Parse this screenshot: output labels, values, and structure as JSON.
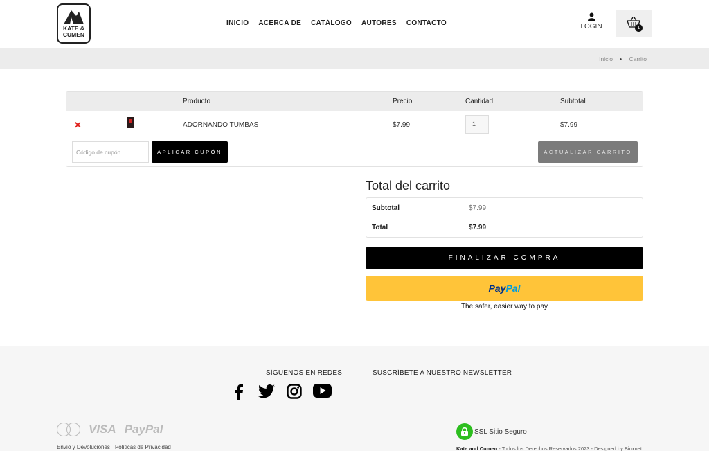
{
  "brand": {
    "logo_text_line1": "KATE &",
    "logo_text_line2": "CUMEN"
  },
  "nav": {
    "items": [
      "INICIO",
      "ACERCA DE",
      "CATÁLOGO",
      "AUTORES",
      "CONTACTO"
    ]
  },
  "header": {
    "login_label": "LOGIN",
    "cart_count": "1"
  },
  "breadcrumb": {
    "home": "Inicio",
    "current": "Carrito"
  },
  "cart": {
    "columns": {
      "product": "Producto",
      "price": "Precio",
      "quantity": "Cantidad",
      "subtotal": "Subtotal"
    },
    "items": [
      {
        "name": "ADORNANDO TUMBAS",
        "price": "$7.99",
        "quantity": "1",
        "subtotal": "$7.99"
      }
    ],
    "coupon_placeholder": "Código de cupón",
    "apply_coupon_label": "APLICAR CUPÓN",
    "update_cart_label": "ACTUALIZAR CARRITO"
  },
  "totals": {
    "title": "Total del carrito",
    "subtotal_label": "Subtotal",
    "subtotal_value": "$7.99",
    "total_label": "Total",
    "total_value": "$7.99",
    "checkout_label": "FINALIZAR COMPRA",
    "paypal_pay": "Pay",
    "paypal_pal": "Pal",
    "paypal_tagline": "The safer, easier way to pay"
  },
  "footer": {
    "follow_title": "SÍGUENOS EN REDES",
    "newsletter_title": "SUSCRÍBETE A NUESTRO NEWSLETTER",
    "social_icons": [
      "facebook-icon",
      "twitter-icon",
      "instagram-icon",
      "youtube-icon"
    ],
    "payment_logos": {
      "mastercard": "MasterCard",
      "visa": "VISA",
      "paypal": "PayPal"
    },
    "links": [
      "Envío y Devoluciones",
      "Políticas de Privacidad"
    ],
    "ssl_label": "SSL Sitio Seguro",
    "copyright_brand": "Kate and Cumen",
    "copyright_text": " - Todos los Derechos Reservados 2023 - Designed by Bioxnet"
  },
  "colors": {
    "remove": "#e0201c",
    "paypal_button": "#ffc439",
    "ssl_badge": "#2dbe1f"
  }
}
